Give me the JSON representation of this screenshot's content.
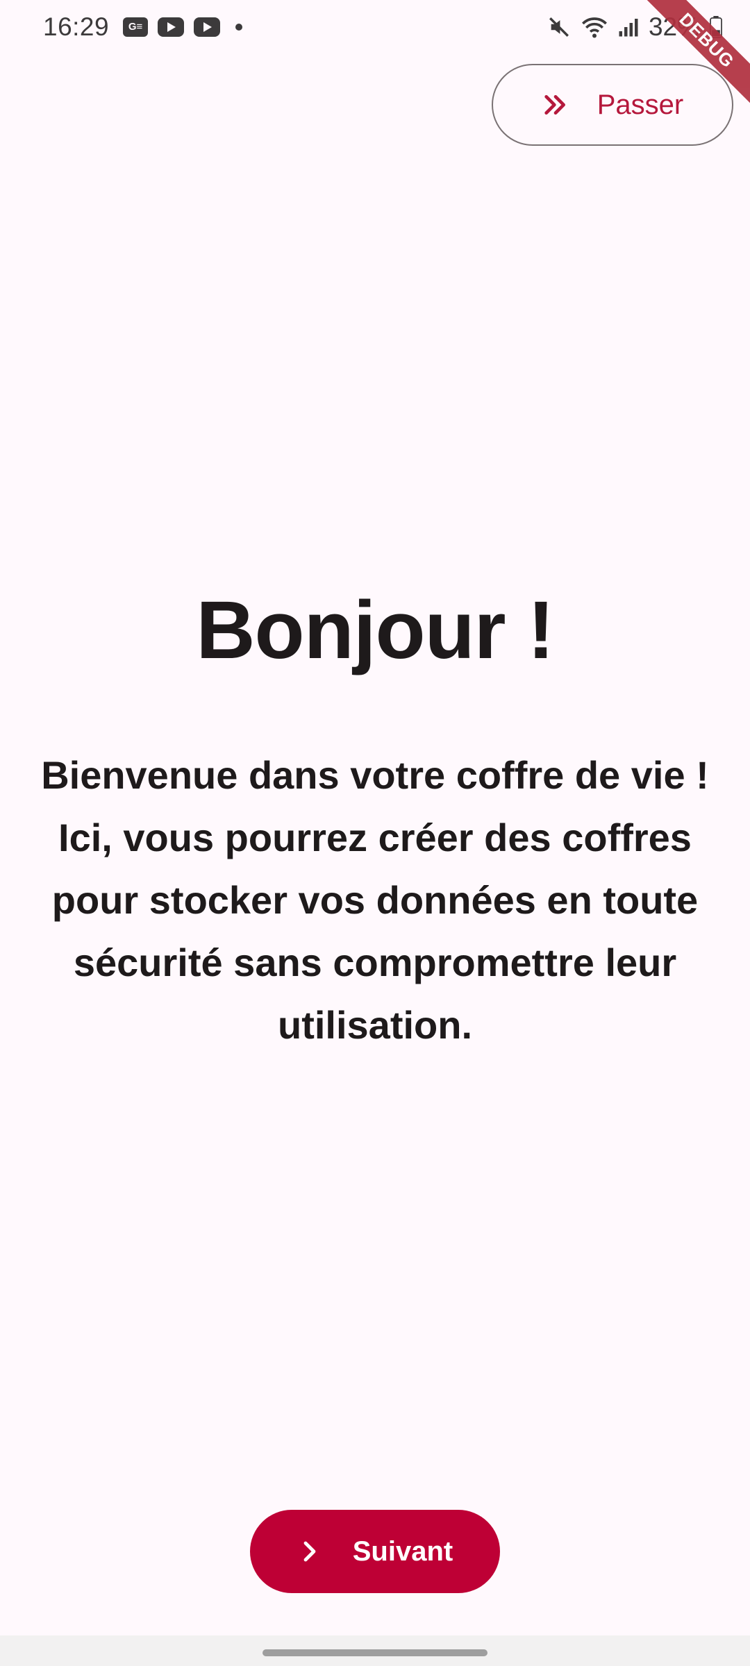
{
  "status_bar": {
    "time": "16:29",
    "notification_icons": [
      "news-icon",
      "youtube-icon",
      "youtube-icon",
      "dot-icon"
    ],
    "status_icons": [
      "mute-icon",
      "wifi-icon",
      "signal-icon",
      "battery-icon"
    ],
    "battery": "32%"
  },
  "debug_banner": {
    "label": "DEBUG"
  },
  "header": {
    "skip_label": "Passer",
    "skip_icon": "double-chevron-right-icon"
  },
  "main": {
    "title": "Bonjour !",
    "description": "Bienvenue dans votre coffre de vie ! Ici, vous pourrez créer des coffres pour stocker vos données en toute sécurité sans compromettre leur utilisation."
  },
  "footer": {
    "next_label": "Suivant",
    "next_icon": "chevron-right-icon"
  },
  "colors": {
    "accent": "#BE0035",
    "background": "#FFF9FD",
    "text": "#1E1A1B",
    "outline": "#7A7274",
    "debug_ribbon": "#B0303F"
  }
}
